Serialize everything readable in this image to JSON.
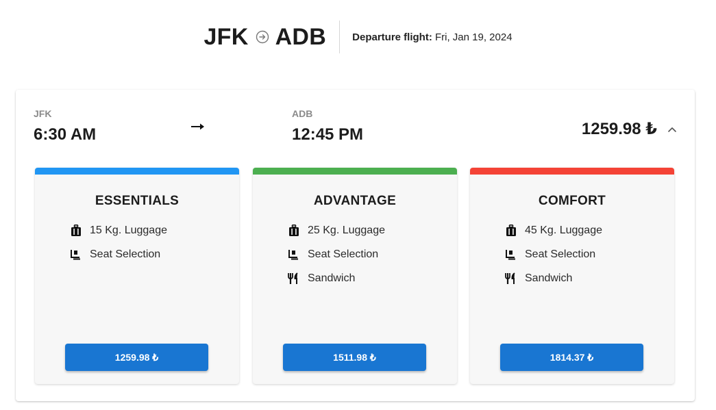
{
  "header": {
    "origin": "JFK",
    "destination": "ADB",
    "departure_label": "Departure flight:",
    "departure_date": "Fri, Jan 19, 2024"
  },
  "flight": {
    "origin_code": "JFK",
    "departure_time": "6:30 AM",
    "destination_code": "ADB",
    "arrival_time": "12:45 PM",
    "price": "1259.98 ₺"
  },
  "fares": [
    {
      "title": "ESSENTIALS",
      "color": "#2196f3",
      "features": [
        {
          "icon": "luggage-icon",
          "label": "15 Kg. Luggage"
        },
        {
          "icon": "seat-icon",
          "label": "Seat Selection"
        }
      ],
      "price": "1259.98 ₺"
    },
    {
      "title": "ADVANTAGE",
      "color": "#4caf50",
      "features": [
        {
          "icon": "luggage-icon",
          "label": "25 Kg. Luggage"
        },
        {
          "icon": "seat-icon",
          "label": "Seat Selection"
        },
        {
          "icon": "meal-icon",
          "label": "Sandwich"
        }
      ],
      "price": "1511.98 ₺"
    },
    {
      "title": "COMFORT",
      "color": "#f44336",
      "features": [
        {
          "icon": "luggage-icon",
          "label": "45 Kg. Luggage"
        },
        {
          "icon": "seat-icon",
          "label": "Seat Selection"
        },
        {
          "icon": "meal-icon",
          "label": "Sandwich"
        }
      ],
      "price": "1814.37 ₺"
    }
  ],
  "colors": {
    "button": "#1976d2"
  }
}
